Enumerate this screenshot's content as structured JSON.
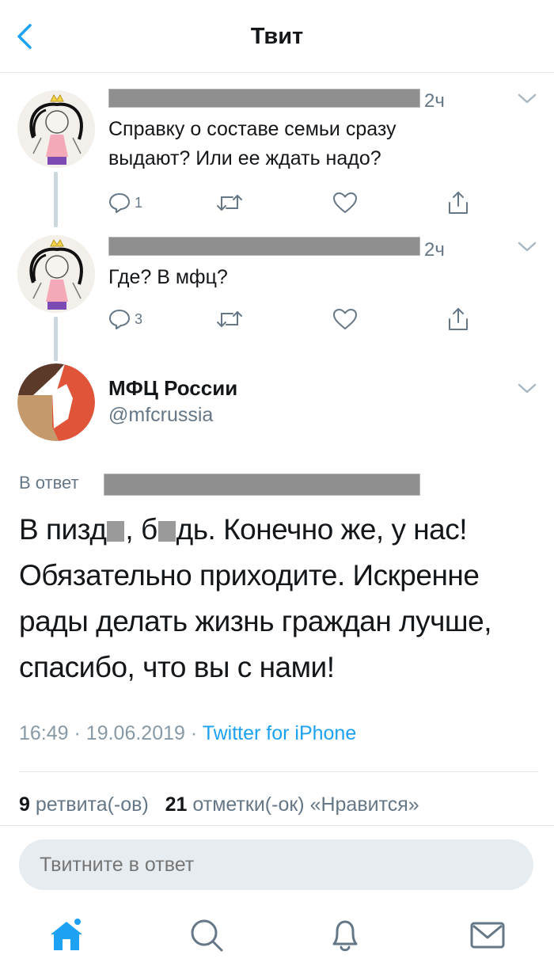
{
  "header": {
    "title": "Твит"
  },
  "thread": [
    {
      "time": "2ч",
      "text": "Справку о составе семьи сразу выдают? Или ее ждать надо?",
      "reply_count": "1"
    },
    {
      "time": "2ч",
      "text": "Где? В мфц?",
      "reply_count": "3"
    }
  ],
  "main_tweet": {
    "name": "МФЦ России",
    "handle": "@mfcrussia",
    "reply_to_label": "В ответ",
    "text_line1_a": "В пизд",
    "text_line1_b": ", б",
    "text_line1_c": "дь. Конечно же, у нас!",
    "text_rest": "Обязательно приходите. Искренне рады делать жизнь граждан лучше, спасибо, что вы с нами!",
    "time": "16:49",
    "date": "19.06.2019",
    "separator": "·",
    "client": "Twitter for iPhone"
  },
  "stats": {
    "retweets_count": "9",
    "retweets_label": "ретвита(-ов)",
    "likes_count": "21",
    "likes_label": "отметки(-ок) «Нравится»"
  },
  "compose": {
    "placeholder": "Твитните в ответ"
  },
  "tabs": [
    "home-icon",
    "search-icon",
    "notifications-icon",
    "messages-icon"
  ],
  "colors": {
    "accent": "#1da1f2",
    "secondary_text": "#657786",
    "brand_orange": "#e0553a",
    "brand_brown": "#5b3a29",
    "brand_tan": "#c49a6c"
  }
}
